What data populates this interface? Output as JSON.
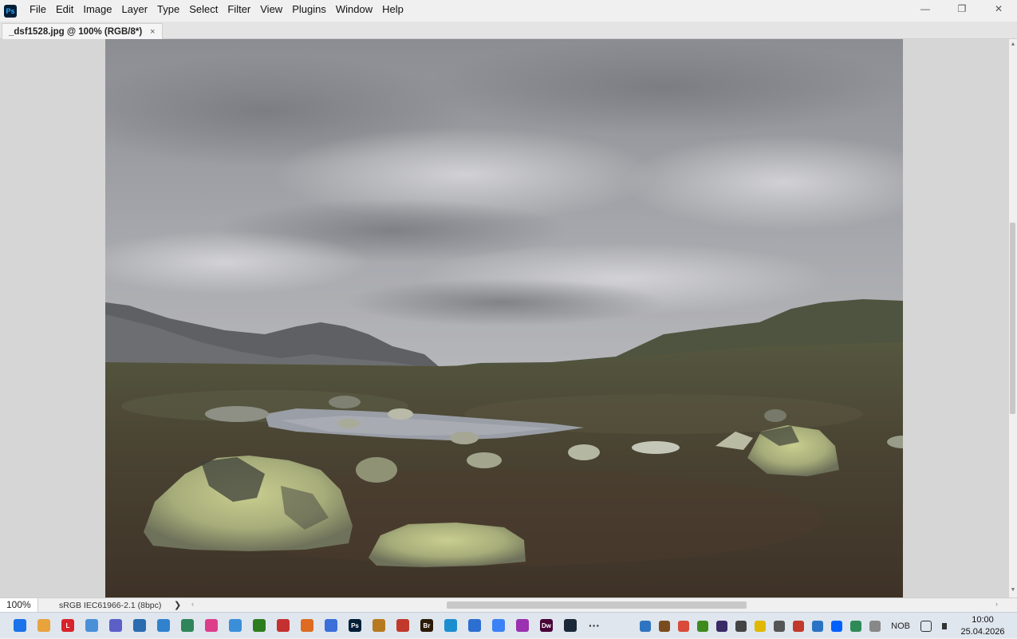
{
  "app": {
    "logo_text": "Ps",
    "menu": [
      "File",
      "Edit",
      "Image",
      "Layer",
      "Type",
      "Select",
      "Filter",
      "View",
      "Plugins",
      "Window",
      "Help"
    ],
    "window_controls": {
      "minimize": "—",
      "restore": "❐",
      "close": "✕"
    }
  },
  "document": {
    "tab_title": "_dsf1528.jpg @ 100% (RGB/8*)",
    "tab_close": "×"
  },
  "status": {
    "zoom": "100%",
    "color_profile": "sRGB IEC61966-2.1 (8bpc)",
    "chevron": "❯",
    "hscroll_left": "‹",
    "hscroll_right": "›",
    "vscroll_up": "▲",
    "vscroll_down": "▼"
  },
  "taskbar": {
    "apps": [
      {
        "name": "windows-start-icon",
        "label": "",
        "color": "#1a73e8"
      },
      {
        "name": "file-explorer-icon",
        "label": "",
        "color": "#e8a33d"
      },
      {
        "name": "lightroom-red-icon",
        "label": "L",
        "color": "#d8232a"
      },
      {
        "name": "screen-capture-icon",
        "label": "",
        "color": "#4a90d9"
      },
      {
        "name": "app-tool-icon",
        "label": "",
        "color": "#5b5fc7"
      },
      {
        "name": "eye-app-icon",
        "label": "",
        "color": "#2b6cb0"
      },
      {
        "name": "network-app-icon",
        "label": "",
        "color": "#3182ce"
      },
      {
        "name": "warning-app-icon",
        "label": "",
        "color": "#2f855a"
      },
      {
        "name": "photo-app-icon",
        "label": "",
        "color": "#dd3e8b"
      },
      {
        "name": "diamond-app-icon",
        "label": "",
        "color": "#3b8fd9"
      },
      {
        "name": "nvidia-icon",
        "label": "",
        "color": "#2d7d1e"
      },
      {
        "name": "red-circle-app-icon",
        "label": "",
        "color": "#c53030"
      },
      {
        "name": "triangle-app-icon",
        "label": "",
        "color": "#dd6b20"
      },
      {
        "name": "code-app-icon",
        "label": "",
        "color": "#3b6fd9"
      },
      {
        "name": "photoshop-icon",
        "label": "Ps",
        "color": "#001e36"
      },
      {
        "name": "paint-app-icon",
        "label": "",
        "color": "#b7791f"
      },
      {
        "name": "acrobat-icon",
        "label": "",
        "color": "#c0392b"
      },
      {
        "name": "bridge-icon",
        "label": "Br",
        "color": "#2b1a06"
      },
      {
        "name": "edge-browser-icon",
        "label": "",
        "color": "#1b8ed0"
      },
      {
        "name": "notes-app-icon",
        "label": "",
        "color": "#2c6fd1"
      },
      {
        "name": "document-app-icon",
        "label": "",
        "color": "#3b82f6"
      },
      {
        "name": "purple-circle-app-icon",
        "label": "",
        "color": "#9b30b0"
      },
      {
        "name": "dreamweaver-icon",
        "label": "Dw",
        "color": "#470137"
      },
      {
        "name": "steam-icon",
        "label": "",
        "color": "#1b2838"
      },
      {
        "name": "more-apps-icon",
        "label": "···",
        "color": "transparent"
      }
    ],
    "tray": [
      {
        "name": "tray-app-1-icon",
        "color": "#2f74c0"
      },
      {
        "name": "tray-app-2-icon",
        "color": "#7a4b1d"
      },
      {
        "name": "tray-app-3-icon",
        "color": "#d94a3a"
      },
      {
        "name": "tray-nvidia-icon",
        "color": "#3f8a1c"
      },
      {
        "name": "tray-app-5-icon",
        "color": "#3a2a66"
      },
      {
        "name": "tray-infinity-icon",
        "color": "#444444"
      },
      {
        "name": "tray-weather-icon",
        "color": "#e0b800"
      },
      {
        "name": "tray-app-8-icon",
        "color": "#555555"
      },
      {
        "name": "tray-app-9-icon",
        "color": "#c0392b"
      },
      {
        "name": "tray-app-10-icon",
        "color": "#2a73c4"
      },
      {
        "name": "tray-dropbox-icon",
        "color": "#0061fe"
      },
      {
        "name": "tray-shield-icon",
        "color": "#2e8b57"
      },
      {
        "name": "tray-send-icon",
        "color": "#888888"
      }
    ],
    "language": "NOB",
    "time": "10:00",
    "date": "25.04.2026"
  }
}
